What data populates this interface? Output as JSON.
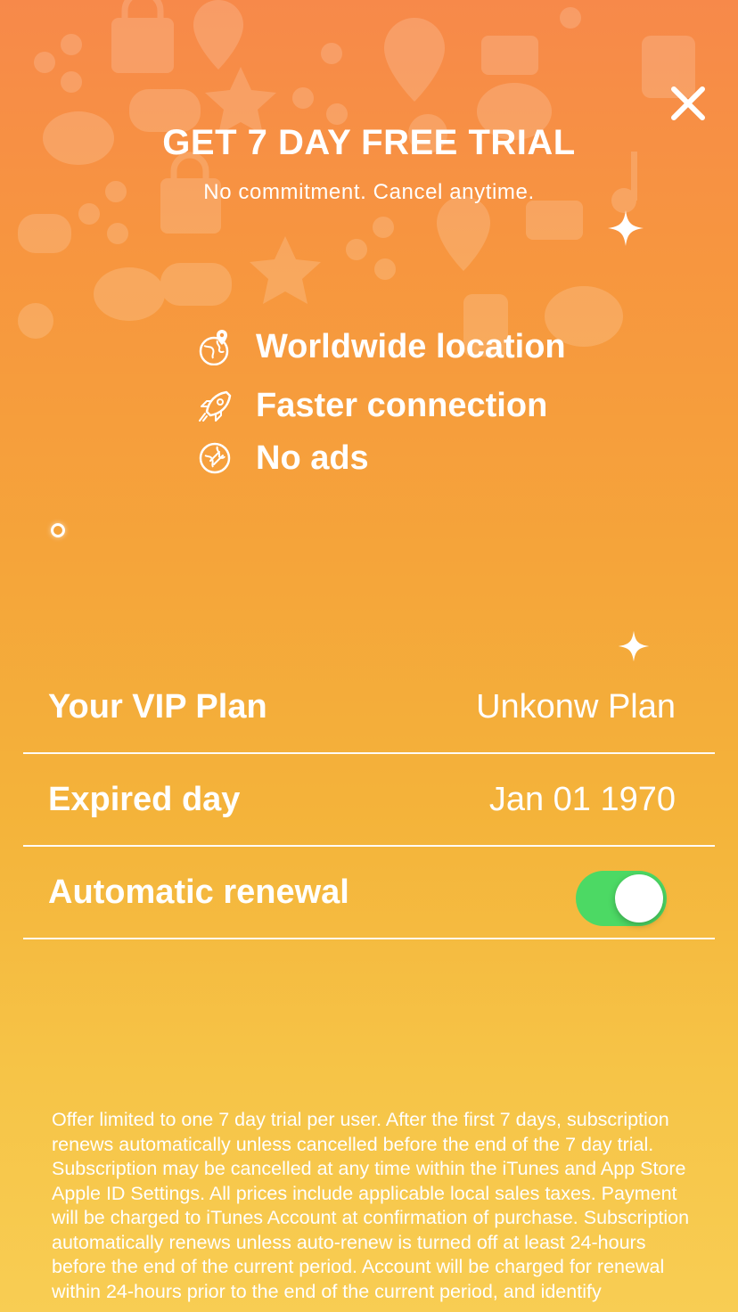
{
  "header": {
    "title": "GET 7 DAY FREE TRIAL",
    "subtitle": "No commitment. Cancel anytime.",
    "close_icon": "close-icon"
  },
  "features": [
    {
      "icon": "globe-pin-icon",
      "label": "Worldwide location"
    },
    {
      "icon": "rocket-icon",
      "label": "Faster connection"
    },
    {
      "icon": "no-ads-icon",
      "label": "No ads"
    }
  ],
  "plan": {
    "vip_plan_label": "Your VIP Plan",
    "vip_plan_value": "Unkonw Plan",
    "expired_label": "Expired day",
    "expired_value": "Jan 01 1970",
    "renewal_label": "Automatic renewal",
    "renewal_enabled": true
  },
  "legal": {
    "text": "Offer limited to one 7 day trial per user. After the first 7 days, subscription renews automatically unless cancelled before the end of the 7 day trial. Subscription may be cancelled at any time within the iTunes and App Store Apple ID Settings. All prices include applicable local sales taxes. Payment will be charged to iTunes Account at confirmation of purchase. Subscription automatically renews unless auto-renew is turned off at least 24-hours before the end of the current period. Account will be charged for renewal within 24-hours prior to the end of the current period, and identify"
  },
  "colors": {
    "background_top": "#f7894a",
    "background_bottom": "#f8cd53",
    "toggle_on": "#4cd964"
  }
}
